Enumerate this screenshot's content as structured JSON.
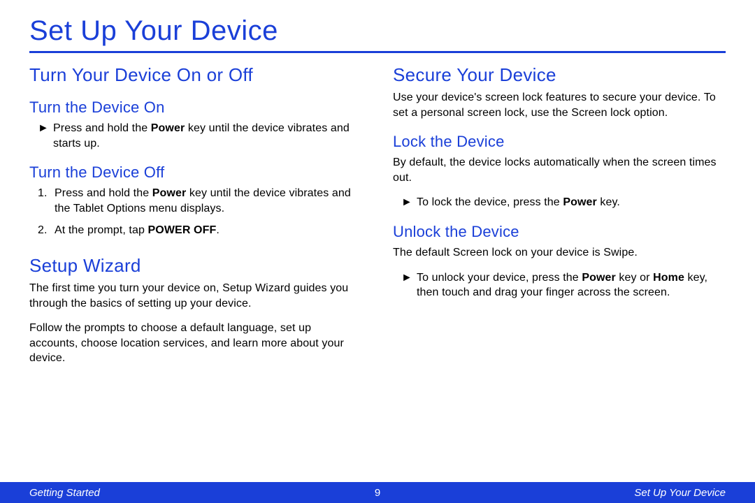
{
  "page_title": "Set Up Your Device",
  "left": {
    "section1": {
      "heading": "Turn Your Device On or Off",
      "sub1": {
        "heading": "Turn the Device On",
        "bullet_pre": "Press and hold the ",
        "bullet_bold": "Power",
        "bullet_post": " key until the device vibrates and starts up."
      },
      "sub2": {
        "heading": "Turn the Device Off",
        "item1_pre": "Press and hold the ",
        "item1_bold": "Power",
        "item1_post": " key until the device vibrates and the Tablet Options menu displays.",
        "item2_pre": "At the prompt, tap ",
        "item2_bold": "POWER OFF",
        "item2_post": "."
      }
    },
    "section2": {
      "heading": "Setup Wizard",
      "p1": "The first time you turn your device on, Setup Wizard guides you through the basics of setting up your device.",
      "p2": "Follow the prompts to choose a default language, set up accounts, choose location services, and learn more about your device."
    }
  },
  "right": {
    "section1": {
      "heading": "Secure Your Device",
      "p1": "Use your device's screen lock features to secure your device. To set a personal screen lock, use the Screen lock option."
    },
    "sub1": {
      "heading": "Lock the Device",
      "p1": "By default, the device locks automatically when the screen times out.",
      "bullet_pre": "To lock the device, press the ",
      "bullet_bold": "Power",
      "bullet_post": " key."
    },
    "sub2": {
      "heading": "Unlock the Device",
      "p1": "The default Screen lock on your device is Swipe.",
      "bullet_pre": "To unlock your device, press the ",
      "bullet_bold1": "Power",
      "bullet_mid": " key or ",
      "bullet_bold2": "Home",
      "bullet_post": " key, then touch and drag your finger across the screen."
    }
  },
  "footer": {
    "left": "Getting Started",
    "center": "9",
    "right": "Set Up Your Device"
  },
  "markers": {
    "triangle": "►",
    "n1": "1.",
    "n2": "2."
  }
}
